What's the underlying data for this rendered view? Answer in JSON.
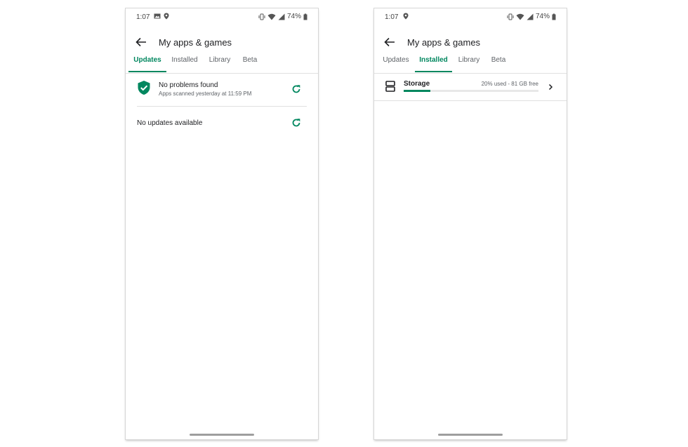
{
  "colors": {
    "accent": "#01875f",
    "text": "#202124",
    "secondary": "#5f6368"
  },
  "left": {
    "status": {
      "time": "1:07",
      "battery": "74%"
    },
    "appbar": {
      "title": "My apps & games"
    },
    "tabs": [
      {
        "label": "Updates",
        "active": true
      },
      {
        "label": "Installed",
        "active": false
      },
      {
        "label": "Library",
        "active": false
      },
      {
        "label": "Beta",
        "active": false
      }
    ],
    "protect": {
      "title": "No problems found",
      "subtitle": "Apps scanned yesterday at 11:59 PM",
      "icon": "shield-check-icon"
    },
    "updates": {
      "text": "No updates available"
    }
  },
  "right": {
    "status": {
      "time": "1:07",
      "battery": "74%"
    },
    "appbar": {
      "title": "My apps & games"
    },
    "tabs": [
      {
        "label": "Updates",
        "active": false
      },
      {
        "label": "Installed",
        "active": true
      },
      {
        "label": "Library",
        "active": false
      },
      {
        "label": "Beta",
        "active": false
      }
    ],
    "storage": {
      "label": "Storage",
      "detail": "20% used - 81 GB free",
      "used_fraction": 0.2
    }
  }
}
